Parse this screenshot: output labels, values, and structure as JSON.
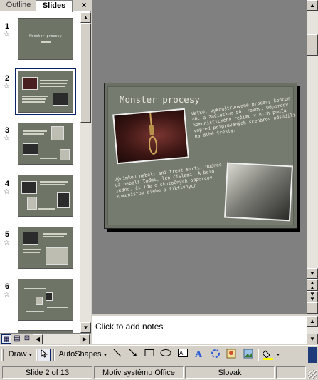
{
  "left_pane": {
    "tabs": {
      "outline": "Outline",
      "slides": "Slides"
    },
    "close_glyph": "×",
    "thumbnails": [
      {
        "number": "1",
        "selected": false
      },
      {
        "number": "2",
        "selected": true
      },
      {
        "number": "3",
        "selected": false
      },
      {
        "number": "4",
        "selected": false
      },
      {
        "number": "5",
        "selected": false
      },
      {
        "number": "6",
        "selected": false
      }
    ],
    "thumb1_title": "Monster procesy",
    "view_buttons": [
      "normal-view-icon",
      "slide-sorter-icon",
      "slide-show-icon"
    ]
  },
  "slide": {
    "title": "Monster procesy",
    "paragraph1": "Veľké, vykonštruované procesy koncom 40. a začiatkom 50. rokov. Odporcov komunistického režimu v nich podľa vopred pripravených scenárov odsúdili na dlhé tresty.",
    "paragraph2": "Výnimkou neboli ani trest smrti. Dodnes už nebolí ľuďmi, len číslami. A bolo jedno, či ide o skutočných odporcov komunistov alebo o fiktívnych."
  },
  "notes": {
    "placeholder": "Click to add notes"
  },
  "toolbar": {
    "draw_label": "Draw",
    "autoshapes_label": "AutoShapes",
    "icons": [
      "line-icon",
      "arrow-icon",
      "rectangle-icon",
      "oval-icon",
      "text-box-icon",
      "wordart-icon",
      "diagram-icon",
      "clip-art-icon",
      "picture-icon",
      "fill-color-icon"
    ]
  },
  "status": {
    "slide_position": "Slide 2 of 13",
    "design": "Motiv systému Office",
    "language": "Slovak"
  },
  "colors": {
    "selection": "#0a246a",
    "workspace": "#808080",
    "slide_bg": "#767b6f"
  }
}
